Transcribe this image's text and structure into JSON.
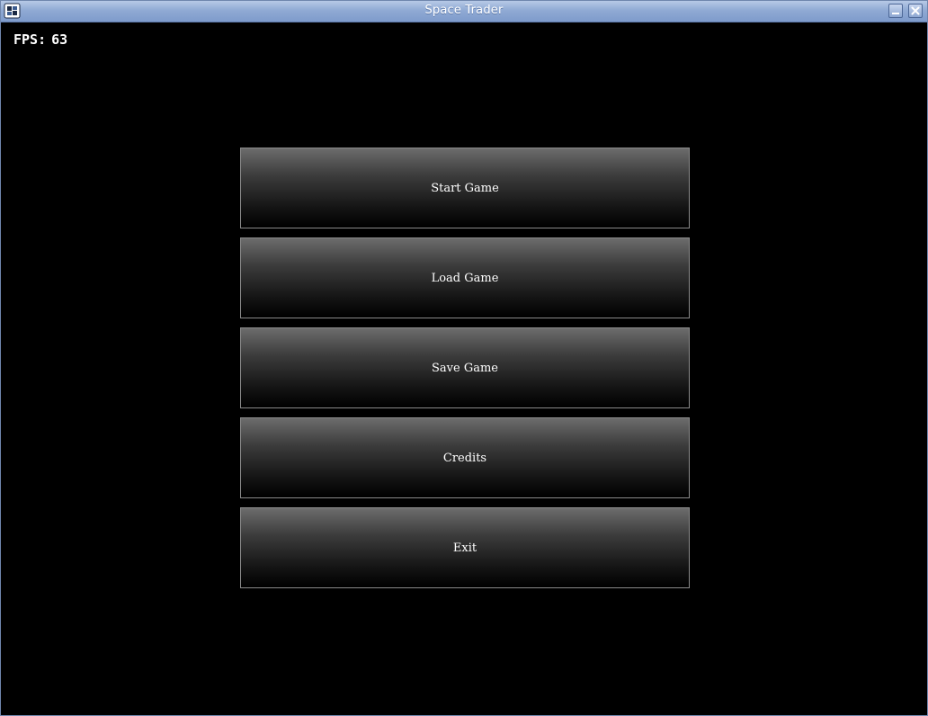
{
  "window": {
    "title": "Space Trader",
    "app_icon": "app-icon",
    "buttons": [
      "minimize-icon",
      "close-icon"
    ],
    "title_bar_color": "#90aad4"
  },
  "hud": {
    "fps_label": "FPS:",
    "fps_value": "63"
  },
  "main_menu": {
    "buttons": [
      {
        "label": "Start Game"
      },
      {
        "label": "Load Game"
      },
      {
        "label": "Save Game"
      },
      {
        "label": "Credits"
      },
      {
        "label": "Exit"
      }
    ]
  }
}
